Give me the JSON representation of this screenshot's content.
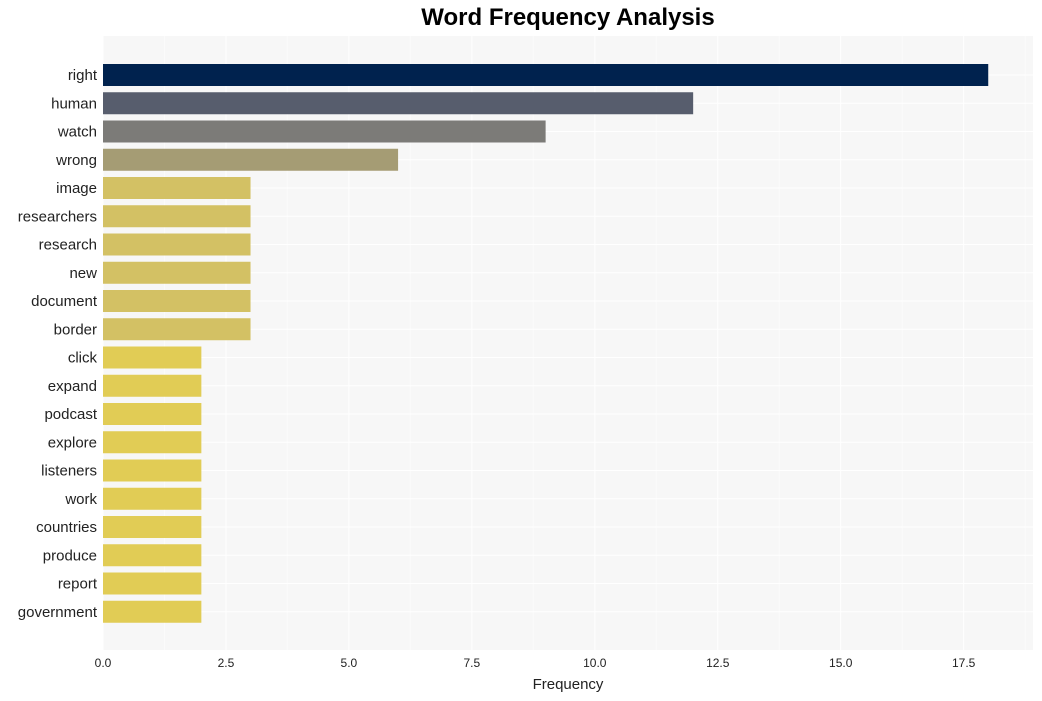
{
  "chart_data": {
    "type": "bar",
    "orientation": "horizontal",
    "title": "Word Frequency Analysis",
    "xlabel": "Frequency",
    "ylabel": "",
    "xlim": [
      0,
      18.9
    ],
    "xticks": [
      0.0,
      2.5,
      5.0,
      7.5,
      10.0,
      12.5,
      15.0,
      17.5
    ],
    "xtick_labels": [
      "0.0",
      "2.5",
      "5.0",
      "7.5",
      "10.0",
      "12.5",
      "15.0",
      "17.5"
    ],
    "grid": true,
    "categories": [
      "right",
      "human",
      "watch",
      "wrong",
      "image",
      "researchers",
      "research",
      "new",
      "document",
      "border",
      "click",
      "expand",
      "podcast",
      "explore",
      "listeners",
      "work",
      "countries",
      "produce",
      "report",
      "government"
    ],
    "values": [
      18,
      12,
      9,
      6,
      3,
      3,
      3,
      3,
      3,
      3,
      2,
      2,
      2,
      2,
      2,
      2,
      2,
      2,
      2,
      2
    ],
    "colors": [
      "#00224e",
      "#575d6d",
      "#7c7b78",
      "#a59c74",
      "#d3c164",
      "#d3c164",
      "#d3c164",
      "#d3c164",
      "#d3c164",
      "#d3c164",
      "#e1cc55",
      "#e1cc55",
      "#e1cc55",
      "#e1cc55",
      "#e1cc55",
      "#e1cc55",
      "#e1cc55",
      "#e1cc55",
      "#e1cc55",
      "#e1cc55"
    ],
    "background": "#f7f7f7"
  }
}
